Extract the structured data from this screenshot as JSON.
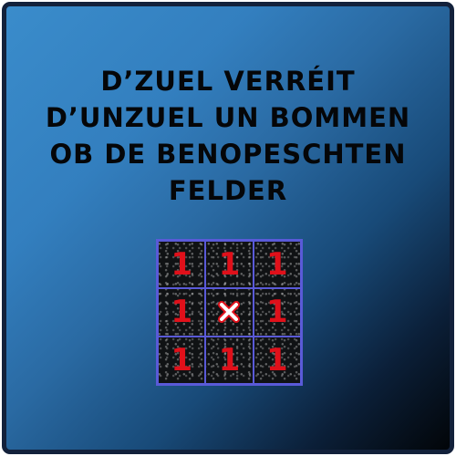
{
  "title_lines": [
    "D’ZUEL VERRÉIT",
    "D’UNZUEL UN BOMMEN",
    "OB DE BENOPESCHTEN",
    "FELDER"
  ],
  "grid": [
    [
      "1",
      "1",
      "1"
    ],
    [
      "1",
      "",
      "1"
    ],
    [
      "1",
      "1",
      "1"
    ]
  ],
  "center_icon": "x-mark-icon",
  "colors": {
    "number": "#e0101a",
    "grid_line": "#5a5ad8",
    "x_mark_stroke": "#e0101a",
    "x_mark_fill": "#ffffff"
  }
}
